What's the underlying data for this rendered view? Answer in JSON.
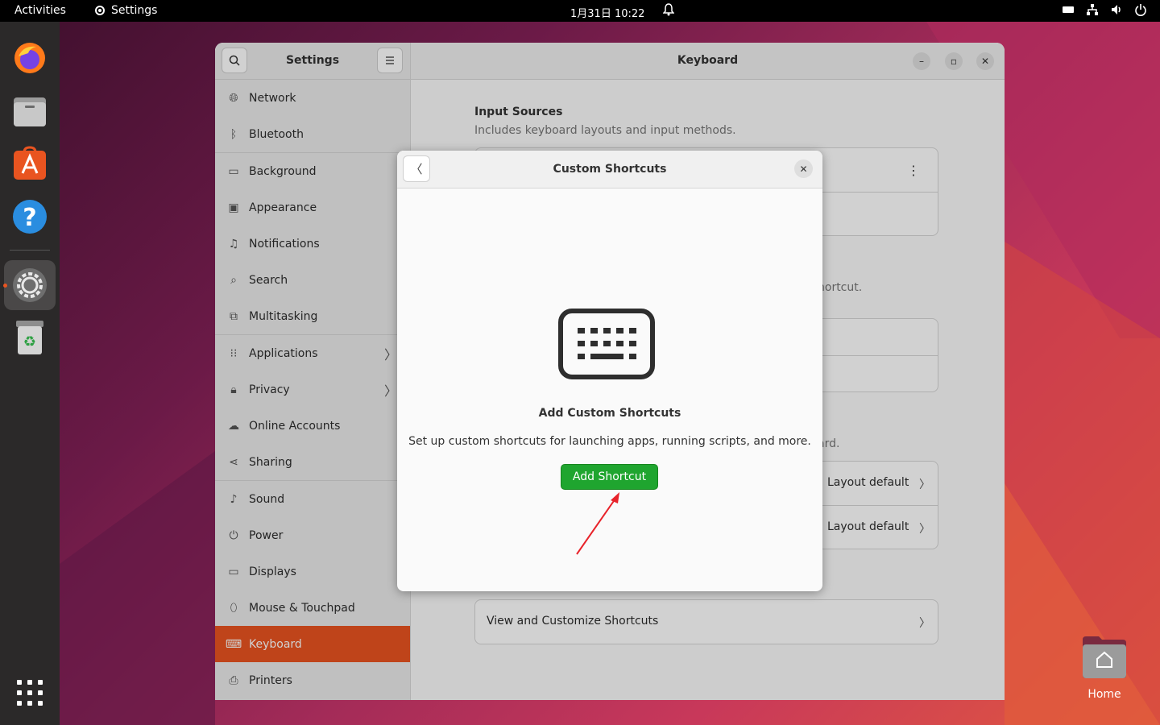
{
  "topbar": {
    "activities": "Activities",
    "app_name": "Settings",
    "clock": "1月31日  10:22"
  },
  "dock": {
    "items": [
      "firefox-icon",
      "files-icon",
      "app-center-icon",
      "help-icon",
      "settings-icon",
      "trash-icon",
      "app-grid-icon"
    ]
  },
  "desktop": {
    "home_label": "Home"
  },
  "sidebar": {
    "title": "Settings",
    "items": [
      {
        "label": "Network",
        "icon": "network-icon"
      },
      {
        "label": "Bluetooth",
        "icon": "bluetooth-icon"
      },
      {
        "label": "Background",
        "icon": "background-icon"
      },
      {
        "label": "Appearance",
        "icon": "appearance-icon"
      },
      {
        "label": "Notifications",
        "icon": "notifications-icon"
      },
      {
        "label": "Search",
        "icon": "search-icon"
      },
      {
        "label": "Multitasking",
        "icon": "multitasking-icon"
      },
      {
        "label": "Applications",
        "icon": "applications-icon"
      },
      {
        "label": "Privacy",
        "icon": "privacy-icon"
      },
      {
        "label": "Online Accounts",
        "icon": "online-accounts-icon"
      },
      {
        "label": "Sharing",
        "icon": "sharing-icon"
      },
      {
        "label": "Sound",
        "icon": "sound-icon"
      },
      {
        "label": "Power",
        "icon": "power-icon"
      },
      {
        "label": "Displays",
        "icon": "displays-icon"
      },
      {
        "label": "Mouse & Touchpad",
        "icon": "mouse-icon"
      },
      {
        "label": "Keyboard",
        "icon": "keyboard-icon"
      },
      {
        "label": "Printers",
        "icon": "printers-icon"
      }
    ],
    "active": "Keyboard"
  },
  "main": {
    "title": "Keyboard",
    "input_sources_title": "Input Sources",
    "input_sources_sub": "Includes keyboard layouts and input methods.",
    "partial_text_1": "hortcut.",
    "partial_text_2": "ard.",
    "layout_default_1": "Layout default",
    "layout_default_2": "Layout default",
    "view_shortcuts": "View and Customize Shortcuts"
  },
  "dialog": {
    "title": "Custom Shortcuts",
    "heading": "Add Custom Shortcuts",
    "description": "Set up custom shortcuts for launching apps, running scripts, and more.",
    "add_button": "Add Shortcut"
  },
  "colors": {
    "accent": "#e95420",
    "add_button": "#1fa52f",
    "annotation_arrow": "#e8232a"
  }
}
